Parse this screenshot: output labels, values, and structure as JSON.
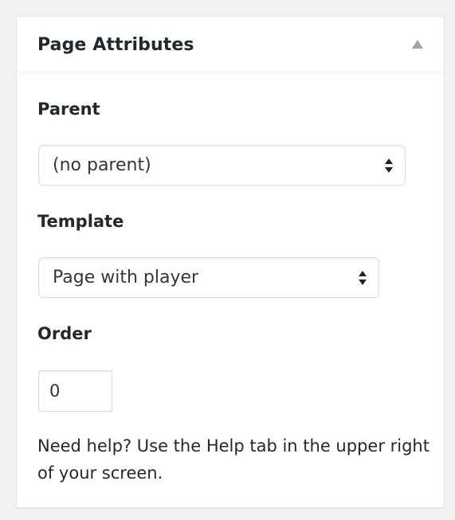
{
  "panel": {
    "title": "Page Attributes"
  },
  "parent": {
    "label": "Parent",
    "selected": "(no parent)"
  },
  "template": {
    "label": "Template",
    "selected": "Page with player"
  },
  "order": {
    "label": "Order",
    "value": "0"
  },
  "help": {
    "text": "Need help? Use the Help tab in the upper right of your screen."
  }
}
